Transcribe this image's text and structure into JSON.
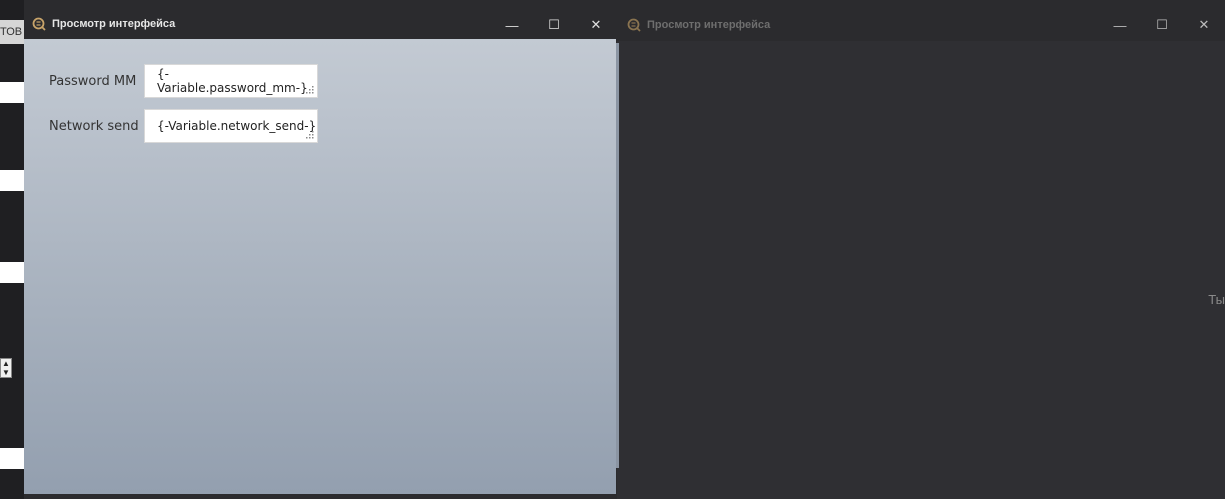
{
  "background_app": {
    "partial_label": "ТОВ"
  },
  "window_active": {
    "title": "Просмотр интерфейса",
    "controls": {
      "minimize": "—",
      "maximize": "☐",
      "close": "✕"
    },
    "fields": [
      {
        "label": "Password MM",
        "value": "{-Variable.password_mm-}"
      },
      {
        "label": "Network send",
        "value": "{-Variable.network_send-}"
      }
    ]
  },
  "window_inactive": {
    "title": "Просмотр интерфейса",
    "controls": {
      "minimize": "—",
      "maximize": "☐",
      "close": "✕"
    },
    "edge_text": "Ты"
  },
  "colors": {
    "accent": "#c8a46a",
    "titlebar": "#2b2b2e",
    "content_top": "#c3cad3",
    "content_bottom": "#939faf"
  },
  "icons": [
    "app-logo-icon",
    "minimize-icon",
    "maximize-icon",
    "close-icon",
    "resize-grip-icon"
  ]
}
